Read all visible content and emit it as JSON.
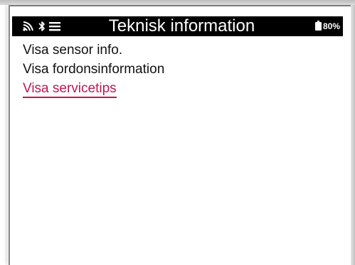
{
  "header": {
    "title": "Teknisk information",
    "battery_text": "80%",
    "icons": [
      "rfid-signal-icon",
      "bluetooth-icon",
      "menu-icon",
      "battery-icon"
    ]
  },
  "menu": {
    "items": [
      {
        "label": "Visa sensor info.",
        "selected": false
      },
      {
        "label": "Visa fordonsinformation",
        "selected": false
      },
      {
        "label": "Visa servicetips",
        "selected": true
      }
    ]
  },
  "colors": {
    "header_bg": "#000000",
    "header_text": "#ffffff",
    "selected_text": "#c4154e",
    "item_text": "#111111"
  }
}
